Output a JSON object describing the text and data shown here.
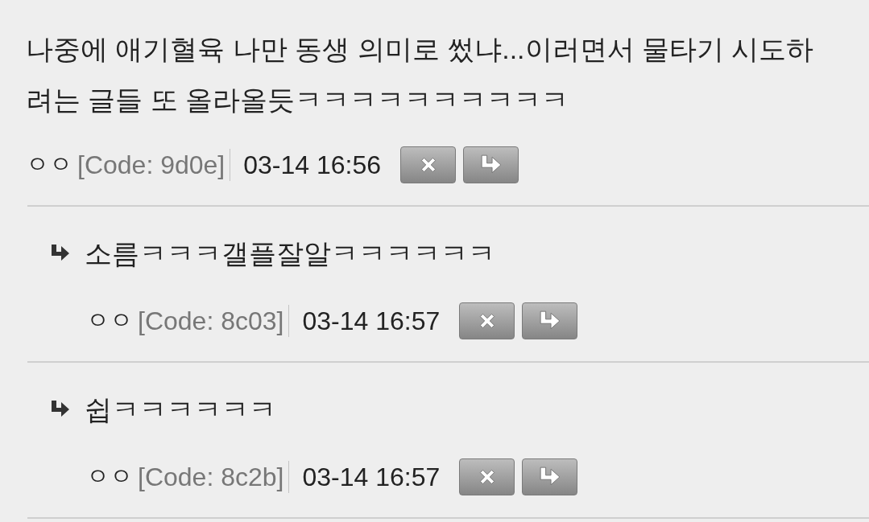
{
  "comments": [
    {
      "text": "나중에 애기혈육 나만 동생 의미로 썼냐...이러면서 물타기 시도하려는 글들 또 올라올듯ㅋㅋㅋㅋㅋㅋㅋㅋㅋㅋ",
      "author": "ㅇㅇ",
      "code": "[Code: 9d0e]",
      "time": "03-14 16:56",
      "replies": [
        {
          "text": "소름ㅋㅋㅋ갤플잘알ㅋㅋㅋㅋㅋㅋ",
          "author": "ㅇㅇ",
          "code": "[Code: 8c03]",
          "time": "03-14 16:57"
        },
        {
          "text": "쉽ㅋㅋㅋㅋㅋㅋ",
          "author": "ㅇㅇ",
          "code": "[Code: 8c2b]",
          "time": "03-14 16:57"
        }
      ]
    }
  ]
}
